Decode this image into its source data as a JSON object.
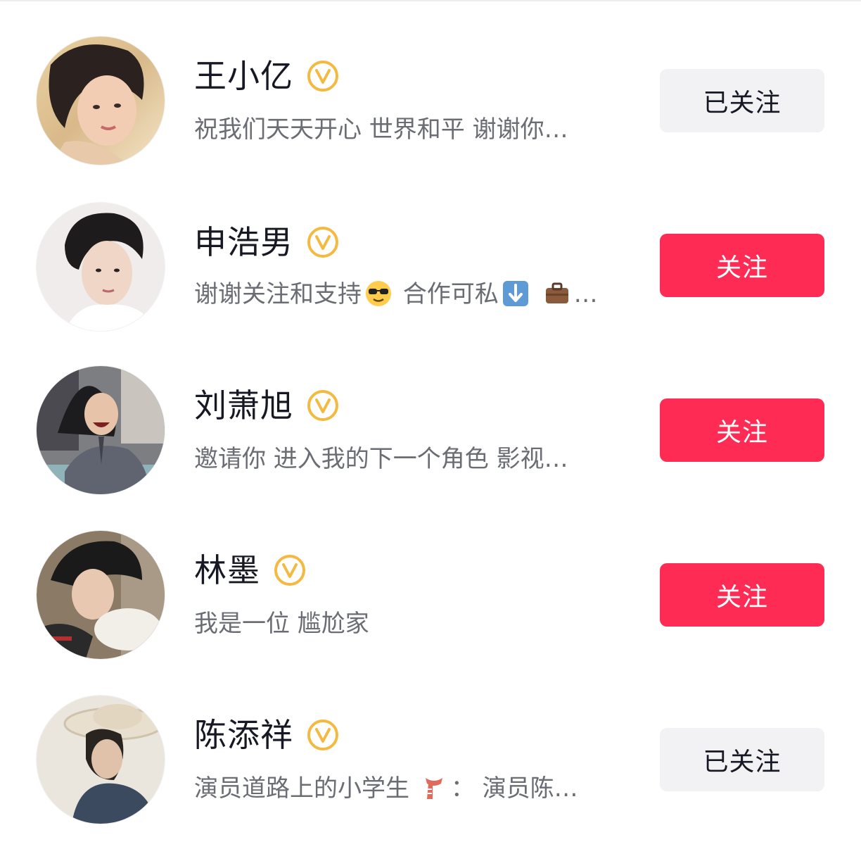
{
  "colors": {
    "follow_bg": "#fe2c55",
    "following_bg": "#f2f2f4",
    "verified_badge": "#f4b940",
    "name_text": "#161823",
    "bio_text": "#6b6d74"
  },
  "users": [
    {
      "name": "王小亿",
      "verified": true,
      "bio": "祝我们天天开心 世界和平 谢谢你…",
      "button_label": "已关注",
      "button_state": "following",
      "avatar_icon": "avatar-photo"
    },
    {
      "name": "申浩男",
      "verified": true,
      "bio_parts": [
        "谢谢关注和支持",
        "合作可私",
        "…"
      ],
      "bio_emojis": [
        "sunglasses-emoji",
        "down-arrow-emoji",
        "briefcase-emoji"
      ],
      "button_label": "关注",
      "button_state": "follow",
      "avatar_icon": "avatar-photo"
    },
    {
      "name": "刘萧旭",
      "verified": true,
      "bio": "邀请你 进入我的下一个角色 影视…",
      "button_label": "关注",
      "button_state": "follow",
      "avatar_icon": "avatar-photo"
    },
    {
      "name": "林墨",
      "verified": true,
      "bio": "我是一位 尴尬家",
      "button_label": "关注",
      "button_state": "follow",
      "avatar_icon": "avatar-photo"
    },
    {
      "name": "陈添祥",
      "verified": true,
      "bio_parts": [
        "演员道路上的小学生",
        "：  演员陈…"
      ],
      "bio_emojis": [
        "scarf-emoji"
      ],
      "button_label": "已关注",
      "button_state": "following",
      "avatar_icon": "avatar-photo"
    }
  ]
}
